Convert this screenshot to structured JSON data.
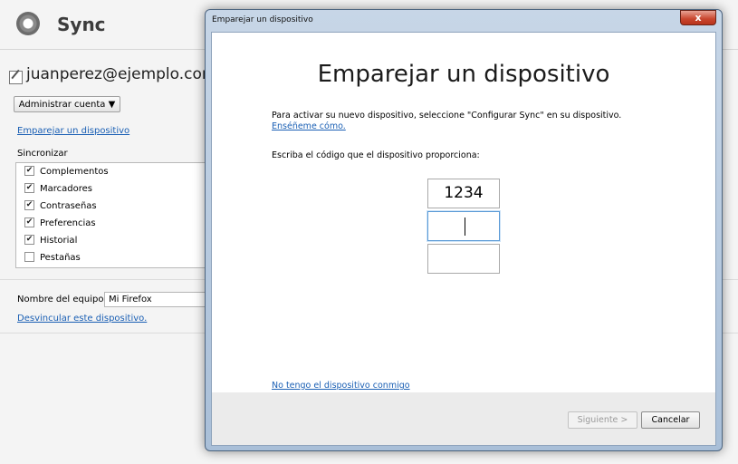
{
  "prefs": {
    "title": "Sync",
    "account_email": "juanperez@ejemplo.com",
    "manage_account_label": "Administrar cuenta ▼",
    "pair_device_link": "Emparejar un dispositivo",
    "sync_label": "Sincronizar",
    "sync_items": [
      {
        "label": "Complementos",
        "checked": true
      },
      {
        "label": "Marcadores",
        "checked": true
      },
      {
        "label": "Contraseñas",
        "checked": true
      },
      {
        "label": "Preferencias",
        "checked": true
      },
      {
        "label": "Historial",
        "checked": true
      },
      {
        "label": "Pestañas",
        "checked": false
      }
    ],
    "device_name_label": "Nombre del equipo:",
    "device_name_value": "Mi Firefox",
    "unlink_link": "Desvincular este dispositivo."
  },
  "dialog": {
    "window_title": "Emparejar un dispositivo",
    "close_glyph": "x",
    "heading": "Emparejar un dispositivo",
    "instruction": "Para activar su nuevo dispositivo, seleccione \"Configurar Sync\" en su dispositivo.",
    "show_me_link": "Enséñeme cómo.",
    "code_prompt": "Escriba el código que el dispositivo proporciona:",
    "code_fields": [
      "1234",
      "",
      ""
    ],
    "no_device_link": "No tengo el dispositivo conmigo",
    "next_button": "Siguiente >",
    "cancel_button": "Cancelar"
  }
}
